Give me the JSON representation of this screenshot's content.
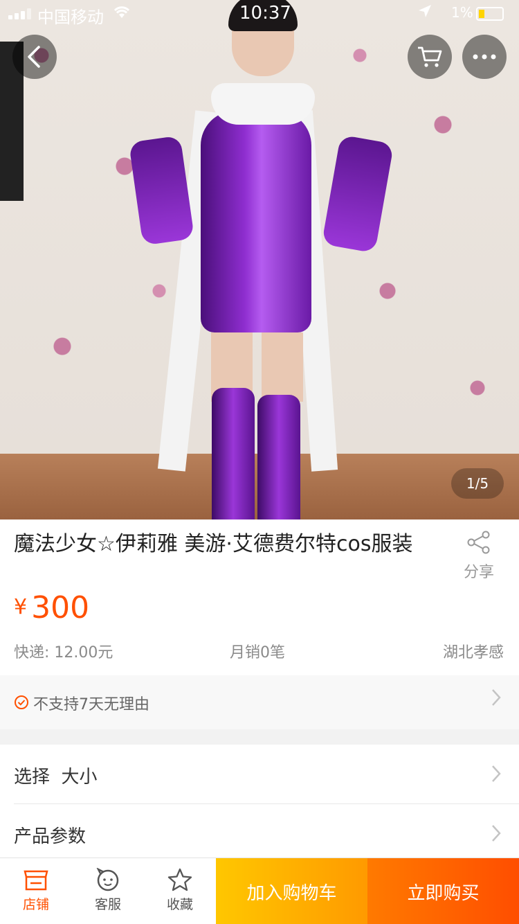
{
  "status_bar": {
    "carrier": "中国移动",
    "time": "10:37",
    "battery": "1%"
  },
  "gallery": {
    "pager": "1/5"
  },
  "product": {
    "title": "魔法少女☆伊莉雅 美游·艾德费尔特cos服装",
    "share_label": "分享",
    "currency": "¥",
    "price": "300",
    "shipping": "快递: 12.00元",
    "monthly_sales": "月销0笔",
    "location": "湖北孝感"
  },
  "guarantee": {
    "text": "不支持7天无理由"
  },
  "rows": {
    "select_label": "选择  大小",
    "params_label": "产品参数"
  },
  "bottom_bar": {
    "shop_label": "店铺",
    "service_label": "客服",
    "favorite_label": "收藏",
    "add_to_cart_label": "加入购物车",
    "buy_now_label": "立即购买"
  },
  "colors": {
    "accent": "#ff5000",
    "add_to_cart": "#ffb400",
    "buy_now": "#ff5a00"
  }
}
